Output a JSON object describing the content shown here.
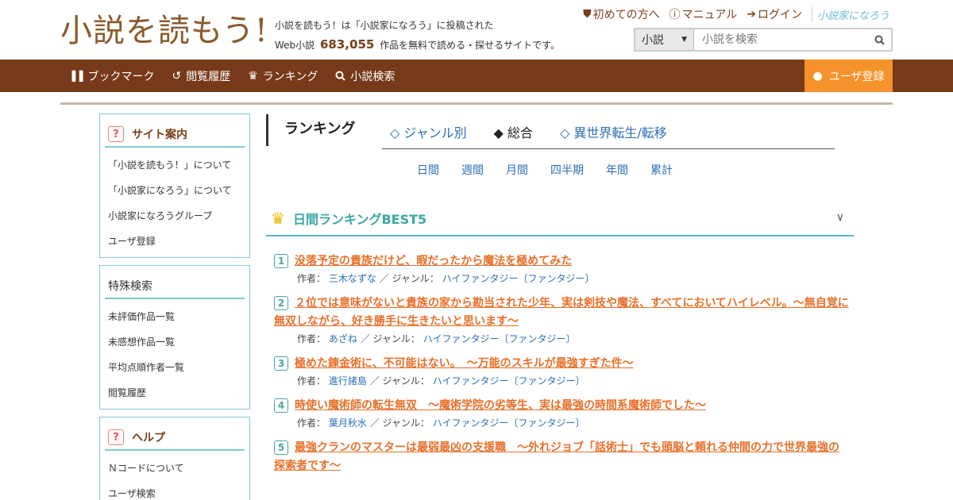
{
  "header": {
    "logo_text": "小説を読もう!",
    "tagline_line1": "小説を読もう！は「小説家になろう」に投稿された",
    "tagline_prefix": "Web小説",
    "tagline_count": "683,055",
    "tagline_suffix": "作品を無料で読める・探せるサイトです。",
    "links": {
      "first_time": "初めての方へ",
      "manual": "マニュアル",
      "login": "ログイン",
      "narou_logo": "小説家になろう"
    },
    "search": {
      "select_value": "小説",
      "placeholder": "小説を検索"
    }
  },
  "nav": {
    "bookmark": "ブックマーク",
    "history": "閲覧履歴",
    "ranking": "ランキング",
    "search": "小説検索",
    "register": "ユーザ登録"
  },
  "sidebar": {
    "site_guide": {
      "title": "サイト案内",
      "items": [
        "「小説を読もう！」について",
        "「小説家になろう」について",
        "小説家になろうグループ",
        "ユーザ登録"
      ]
    },
    "special_search": {
      "title": "特殊検索",
      "items": [
        "未評価作品一覧",
        "未感想作品一覧",
        "平均点順作者一覧",
        "閲覧履歴"
      ]
    },
    "help": {
      "title": "ヘルプ",
      "items": [
        "Ｎコードについて",
        "ユーザ検索"
      ]
    }
  },
  "main": {
    "ranking_title": "ランキング",
    "tabs": {
      "genre": "◇ ジャンル別",
      "overall": "◆ 総合",
      "isekai": "◇ 異世界転生/転移"
    },
    "periods": [
      "日間",
      "週間",
      "月間",
      "四半期",
      "年間",
      "累計"
    ],
    "best5_title": "日間ランキングBEST5",
    "author_label": "作者：",
    "genre_label": "ジャンル：",
    "separator": "／",
    "items": [
      {
        "rank": "1",
        "title": "没落予定の貴族だけど、暇だったから魔法を極めてみた",
        "author": "三木なずな",
        "genre": "ハイファンタジー〔ファンタジー〕"
      },
      {
        "rank": "2",
        "title": "２位では意味がないと貴族の家から勘当された少年、実は剣技や魔法、すべてにおいてハイレベル。～無自覚に無双しながら、好き勝手に生きたいと思います～",
        "author": "あざね",
        "genre": "ハイファンタジー〔ファンタジー〕"
      },
      {
        "rank": "3",
        "title": "極めた錬金術に、不可能はない。　～万能のスキルが最強すぎた件～",
        "author": "進行諸島",
        "genre": "ハイファンタジー〔ファンタジー〕"
      },
      {
        "rank": "4",
        "title": "時使い魔術師の転生無双　～魔術学院の劣等生、実は最強の時間系魔術師でした～",
        "author": "葉月秋水",
        "genre": "ハイファンタジー〔ファンタジー〕"
      },
      {
        "rank": "5",
        "title": "最強クランのマスターは最弱最凶の支援職　～外れジョブ「話術士」でも頭脳と頼れる仲間の力で世界最強の探索者です～",
        "author": "",
        "genre": ""
      }
    ]
  }
}
